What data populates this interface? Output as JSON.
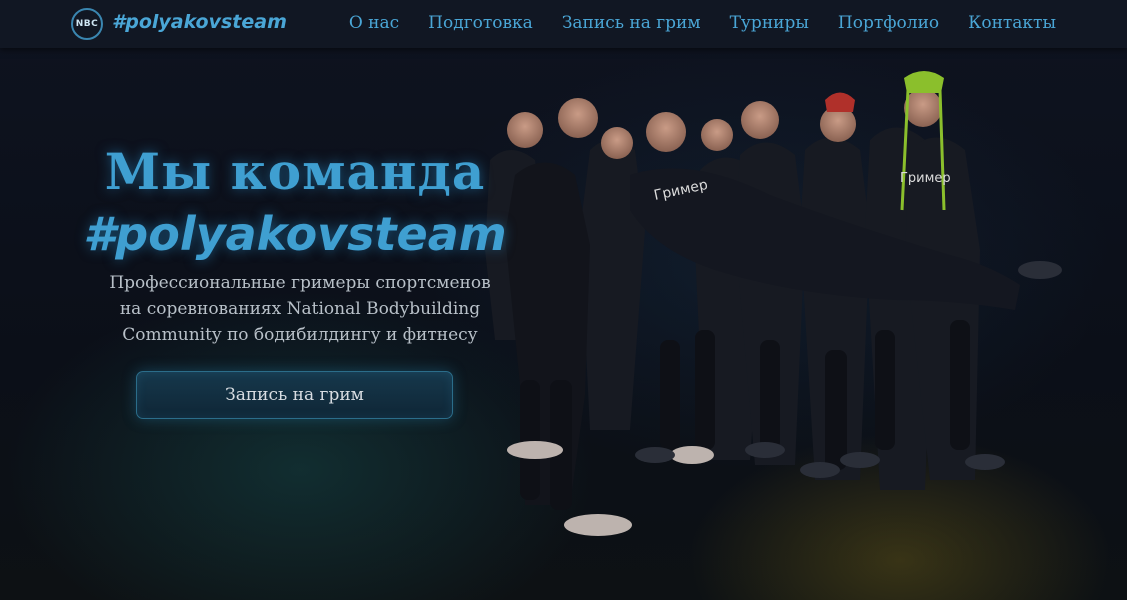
{
  "header": {
    "logo_text": "NBC",
    "brand": "#polyakovsteam",
    "nav": [
      "О нас",
      "Подготовка",
      "Запись на грим",
      "Турниры",
      "Портфолио",
      "Контакты"
    ]
  },
  "hero": {
    "title_line1": "Мы команда",
    "title_line2": "#polyakovsteam",
    "subtitle_lines": [
      "Профессиональные гримеры спортсменов",
      "на соревнованиях National Bodybuilding",
      "Community по бодибилдингу и фитнесу"
    ],
    "cta_label": "Запись на грим",
    "shirt_text": "Гример"
  },
  "colors": {
    "accent": "#4aa6d6",
    "background": "#0c1018",
    "navbar": "#111723",
    "body_text": "#b8c0c8"
  }
}
